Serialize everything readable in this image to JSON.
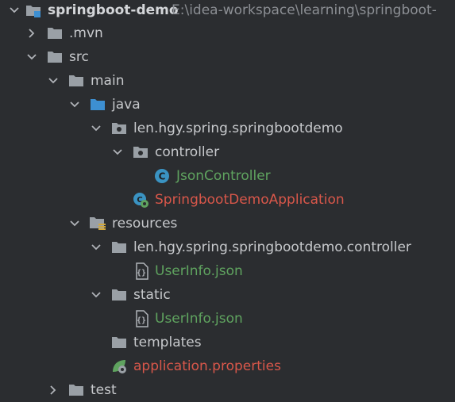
{
  "root": {
    "label": "springboot-demo",
    "path": "E:\\idea-workspace\\learning\\springboot-"
  },
  "items": [
    {
      "label": ".mvn"
    },
    {
      "label": "src"
    },
    {
      "label": "main"
    },
    {
      "label": "java"
    },
    {
      "label": "len.hgy.spring.springbootdemo"
    },
    {
      "label": "controller"
    },
    {
      "label": "JsonController"
    },
    {
      "label": "SpringbootDemoApplication"
    },
    {
      "label": "resources"
    },
    {
      "label": "len.hgy.spring.springbootdemo.controller"
    },
    {
      "label": "UserInfo.json"
    },
    {
      "label": "static"
    },
    {
      "label": "UserInfo.json"
    },
    {
      "label": "templates"
    },
    {
      "label": "application.properties"
    },
    {
      "label": "test"
    }
  ],
  "colors": {
    "background": "#2b2d30",
    "text": "#c7c9cc",
    "modified_green": "#5fa35f",
    "untracked_red": "#d9574a",
    "folder": "#9aa0a6",
    "source_folder": "#3d8fd1",
    "class_icon": "#3a93c2"
  }
}
